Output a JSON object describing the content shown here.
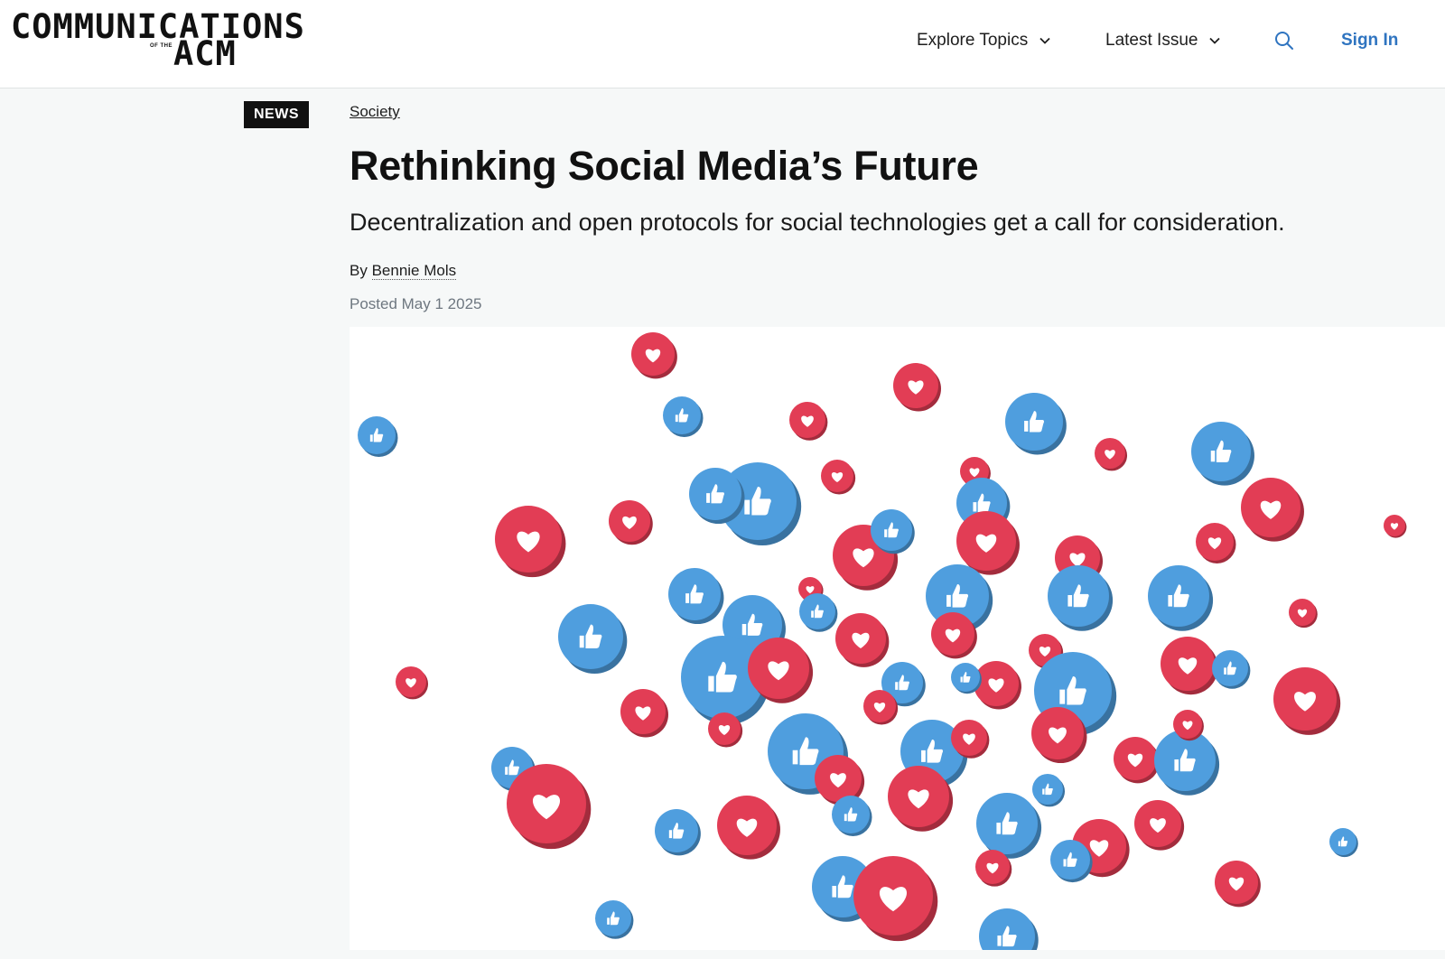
{
  "header": {
    "logo_main": "COMMUNICATIONS",
    "logo_small": "OF THE",
    "logo_acm": "ACM",
    "nav": [
      {
        "label": "Explore Topics"
      },
      {
        "label": "Latest Issue"
      }
    ],
    "search_icon": "search-icon",
    "sign_in": "Sign In",
    "accent_color": "#2f74c0"
  },
  "article": {
    "badge": "NEWS",
    "category": "Society",
    "title": "Rethinking Social Media’s Future",
    "subtitle": "Decentralization and open protocols for social technologies get a call for consideration.",
    "by_prefix": "By",
    "author": "Bennie Mols",
    "posted": "Posted May 1 2025"
  },
  "hero_image": {
    "icons": [
      "heart-icon",
      "thumbs-up-icon"
    ],
    "heart_color": "#e23d55",
    "like_color": "#4f9ede"
  }
}
